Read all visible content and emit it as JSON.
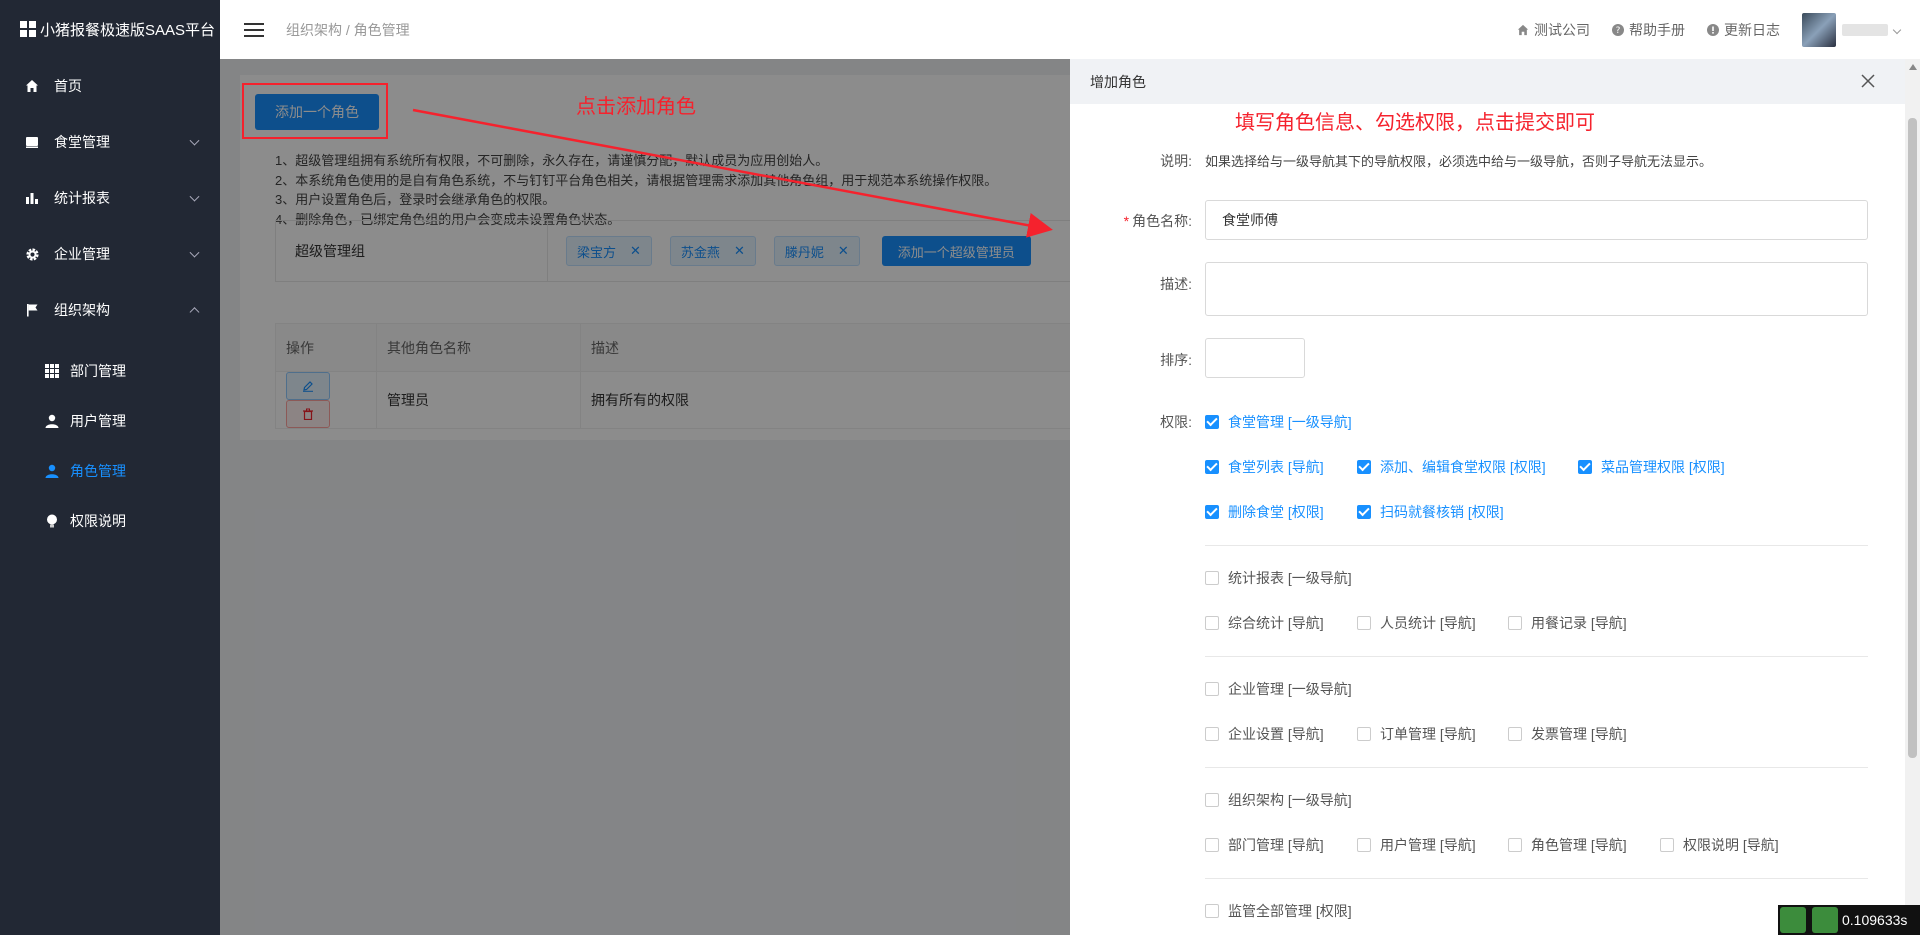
{
  "sidebar": {
    "brand": "小猪报餐极速版SAAS平台",
    "menu": [
      {
        "label": "首页"
      },
      {
        "label": "食堂管理"
      },
      {
        "label": "统计报表"
      },
      {
        "label": "企业管理"
      },
      {
        "label": "组织架构"
      }
    ],
    "submenu": [
      {
        "label": "部门管理"
      },
      {
        "label": "用户管理"
      },
      {
        "label": "角色管理"
      },
      {
        "label": "权限说明"
      }
    ]
  },
  "header": {
    "breadcrumb": "组织架构 / 角色管理",
    "links": [
      {
        "label": "测试公司"
      },
      {
        "label": "帮助手册"
      },
      {
        "label": "更新日志"
      }
    ]
  },
  "main": {
    "add_role_button": "添加一个角色",
    "notes": [
      "1、超级管理组拥有系统所有权限，不可删除，永久存在，请谨慎分配，默认成员为应用创始人。",
      "2、本系统角色使用的是自有角色系统，不与钉钉平台角色相关，请根据管理需求添加其他角色组，用于规范本系统操作权限。",
      "3、用户设置角色后，登录时会继承角色的权限。",
      "4、删除角色，已绑定角色组的用户会变成未设置角色状态。"
    ],
    "super_group": {
      "label": "超级管理组",
      "members": [
        "梁宝方",
        "苏金燕",
        "滕丹妮"
      ],
      "add_button": "添加一个超级管理员"
    },
    "table": {
      "headers": [
        "操作",
        "其他角色名称",
        "描述"
      ],
      "rows": [
        {
          "name": "管理员",
          "desc": "拥有所有的权限"
        }
      ]
    }
  },
  "annotations": {
    "left": "点击添加角色",
    "right": "填写角色信息、勾选权限，点击提交即可"
  },
  "drawer": {
    "title": "增加角色",
    "labels": {
      "note": "说明:",
      "name": "角色名称:",
      "desc": "描述:",
      "sort": "排序:",
      "perm": "权限:"
    },
    "note_text": "如果选择给与一级导航其下的导航权限，必须选中给与一级导航，否则子导航无法显示。",
    "role_name_value": "食堂师傅",
    "permissions": {
      "canteen": {
        "main": "食堂管理 [一级导航]",
        "items": [
          "食堂列表 [导航]",
          "添加、编辑食堂权限 [权限]",
          "菜品管理权限 [权限]",
          "删除食堂 [权限]",
          "扫码就餐核销 [权限]"
        ]
      },
      "stats": {
        "main": "统计报表 [一级导航]",
        "items": [
          "综合统计 [导航]",
          "人员统计 [导航]",
          "用餐记录 [导航]"
        ]
      },
      "company": {
        "main": "企业管理 [一级导航]",
        "items": [
          "企业设置 [导航]",
          "订单管理 [导航]",
          "发票管理 [导航]"
        ]
      },
      "org": {
        "main": "组织架构 [一级导航]",
        "items": [
          "部门管理 [导航]",
          "用户管理 [导航]",
          "角色管理 [导航]",
          "权限说明 [导航]"
        ]
      },
      "supervise": "监管全部管理 [权限]"
    }
  },
  "timer": "0.109633s",
  "colors": {
    "accent": "#1890ff",
    "sidebar_bg": "#222834",
    "annotation_red": "#f5222d"
  }
}
